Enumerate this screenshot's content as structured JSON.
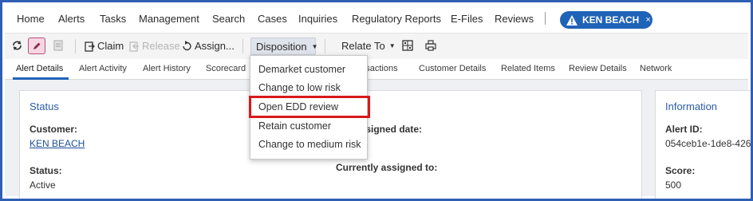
{
  "topnav": {
    "items": [
      "Home",
      "Alerts",
      "Tasks",
      "Management",
      "Search",
      "Cases",
      "Inquiries",
      "Regulatory Reports",
      "E-Files",
      "Reviews"
    ],
    "badge_label": "KEN BEACH",
    "badge_close": "×"
  },
  "toolbar": {
    "claim": "Claim",
    "release": "Release",
    "assign": "Assign...",
    "disposition": "Disposition",
    "relate_to": "Relate To"
  },
  "tabs": [
    "Alert Details",
    "Alert Activity",
    "Alert History",
    "Scorecard",
    "Transactions",
    "Customer Details",
    "Related Items",
    "Review Details",
    "Network"
  ],
  "status_card": {
    "title": "Status",
    "customer_label": "Customer:",
    "customer_value": "KEN BEACH",
    "assigned_date_label": "Assigned date:",
    "status_label": "Status:",
    "status_value": "Active",
    "assigned_to_label": "Currently assigned to:"
  },
  "info_card": {
    "title": "Information",
    "alert_id_label": "Alert ID:",
    "alert_id_value": "054ceb1e-1de8-426",
    "score_label": "Score:",
    "score_value": "500"
  },
  "disposition_menu": {
    "items": [
      "Demarket customer",
      "Change to low risk",
      "Open EDD review",
      "Retain customer",
      "Change to medium risk"
    ],
    "highlighted_index": 2,
    "highlight_color": "#d71a1a"
  },
  "colors": {
    "accent": "#1f63b8",
    "frame": "#2f5fb3",
    "title_blue": "#2a5ea8"
  }
}
